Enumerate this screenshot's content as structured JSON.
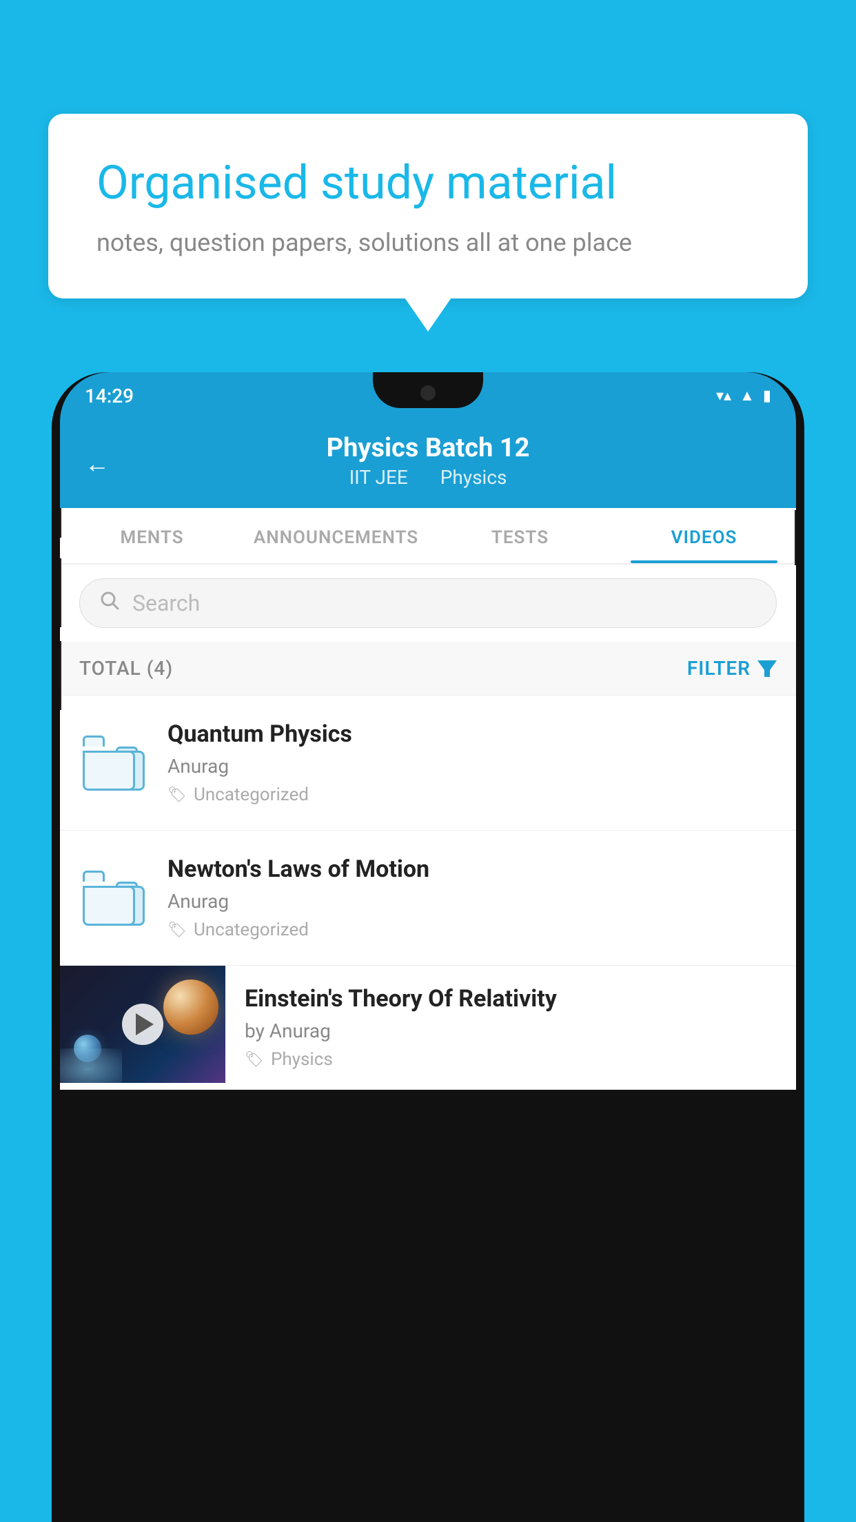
{
  "background_color": "#1ab8e8",
  "speech_bubble": {
    "title": "Organised study material",
    "subtitle": "notes, question papers, solutions all at one place"
  },
  "phone": {
    "status_bar": {
      "time": "14:29",
      "icons": [
        "wifi",
        "signal",
        "battery"
      ]
    },
    "header": {
      "back_label": "←",
      "title": "Physics Batch 12",
      "subtitle_part1": "IIT JEE",
      "subtitle_part2": "Physics"
    },
    "tabs": [
      {
        "label": "MENTS",
        "active": false
      },
      {
        "label": "ANNOUNCEMENTS",
        "active": false
      },
      {
        "label": "TESTS",
        "active": false
      },
      {
        "label": "VIDEOS",
        "active": true
      }
    ],
    "search": {
      "placeholder": "Search"
    },
    "filter_bar": {
      "total_label": "TOTAL (4)",
      "filter_label": "FILTER"
    },
    "videos": [
      {
        "title": "Quantum Physics",
        "author": "Anurag",
        "tag": "Uncategorized",
        "has_thumb": false
      },
      {
        "title": "Newton's Laws of Motion",
        "author": "Anurag",
        "tag": "Uncategorized",
        "has_thumb": false
      },
      {
        "title": "Einstein's Theory Of Relativity",
        "author": "by Anurag",
        "tag": "Physics",
        "has_thumb": true
      }
    ]
  }
}
